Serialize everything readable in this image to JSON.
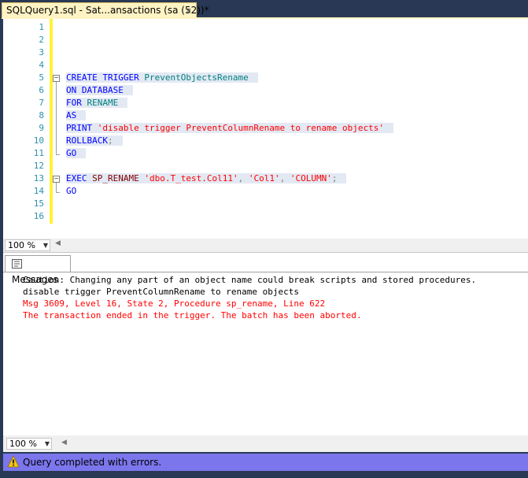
{
  "tab": {
    "title": "SQLQuery1.sql - Sat...ansactions (sa (52))*",
    "close_glyph": "×"
  },
  "editor": {
    "line_numbers": [
      "1",
      "2",
      "3",
      "4",
      "5",
      "6",
      "7",
      "8",
      "9",
      "10",
      "11",
      "12",
      "13",
      "14",
      "15",
      "16"
    ],
    "code": {
      "l5_kw": "CREATE TRIGGER",
      "l5_id": "PreventObjectsRename",
      "l6_kw": "ON DATABASE",
      "l7_kw": "FOR",
      "l7_id": "RENAME",
      "l8_kw": "AS",
      "l9_kw": "PRINT",
      "l9_str": "'disable trigger PreventColumnRename to rename objects'",
      "l10_kw": "ROLLBACK",
      "l10_sep": ";",
      "l11_kw": "GO",
      "l13_kw": "EXEC",
      "l13_fn": "SP_RENAME",
      "l13_s1": "'dbo.T_test.Col11'",
      "l13_c1": ",",
      "l13_s2": "'Col1'",
      "l13_c2": ",",
      "l13_s3": "'COLUMN'",
      "l13_sep": ";",
      "l14_kw": "GO"
    },
    "fold_glyph": "−"
  },
  "zoom_top": {
    "value": "100 %"
  },
  "messages": {
    "tab_label": "Messages",
    "lines": [
      "Caution: Changing any part of an object name could break scripts and stored procedures.",
      "disable trigger PreventColumnRename to rename objects",
      "Msg 3609, Level 16, State 2, Procedure sp_rename, Line 622",
      "The transaction ended in the trigger. The batch has been aborted."
    ]
  },
  "zoom_bottom": {
    "value": "100 %"
  },
  "status": {
    "text": "Query completed with errors.",
    "icon": "warning-icon"
  },
  "colors": {
    "keyword": "#0000ff",
    "identifier": "#008080",
    "string": "#ff0000",
    "error": "#ff0000",
    "status_bar": "#7b76ec"
  }
}
